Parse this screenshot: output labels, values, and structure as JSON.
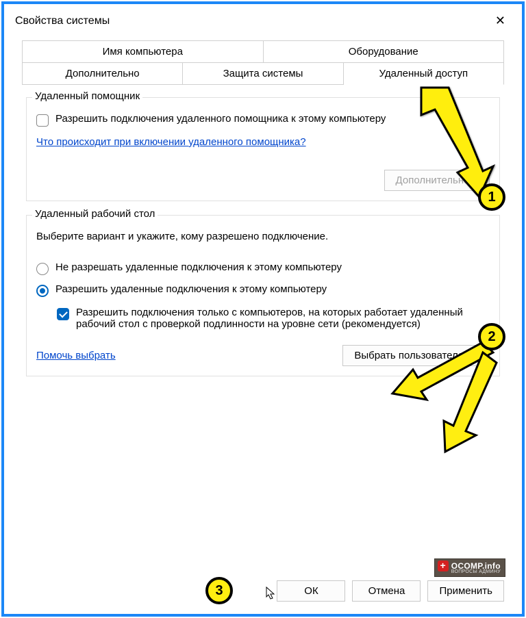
{
  "window": {
    "title": "Свойства системы",
    "close": "✕"
  },
  "tabs": {
    "row1": [
      "Имя компьютера",
      "Оборудование"
    ],
    "row2": [
      "Дополнительно",
      "Защита системы",
      "Удаленный доступ"
    ],
    "active": "Удаленный доступ"
  },
  "remote_assistance": {
    "group_title": "Удаленный помощник",
    "allow_checkbox": "Разрешить подключения удаленного помощника к этому компьютеру",
    "help_link": "Что происходит при включении удаленного помощника?",
    "advanced_btn": "Дополнительно..."
  },
  "remote_desktop": {
    "group_title": "Удаленный рабочий стол",
    "intro": "Выберите вариант и укажите, кому разрешено подключение.",
    "radio_deny": "Не разрешать удаленные подключения к этому компьютеру",
    "radio_allow": "Разрешить удаленные подключения к этому компьютеру",
    "nla_checkbox": "Разрешить подключения только с компьютеров, на которых работает удаленный рабочий стол с проверкой подлинности на уровне сети (рекомендуется)",
    "help_link": "Помочь выбрать",
    "select_users_btn": "Выбрать пользователей..."
  },
  "footer": {
    "ok": "ОК",
    "cancel": "Отмена",
    "apply": "Применить"
  },
  "annotations": {
    "n1": "1",
    "n2": "2",
    "n3": "3",
    "watermark": "OCOMP.info",
    "watermark_sub": "ВОПРОСЫ АДМИНУ"
  }
}
